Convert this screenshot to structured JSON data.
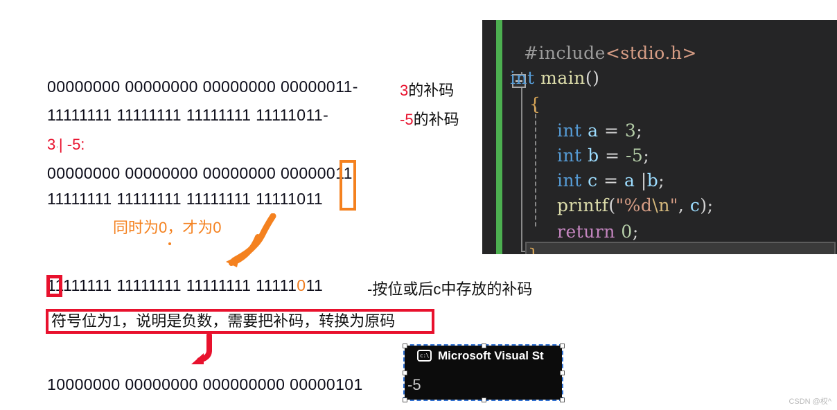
{
  "annotations": {
    "three_complement_bits": "00000000 00000000 00000000 00000011-",
    "three_complement_value": "3",
    "three_complement_label": "的补码",
    "negfive_complement_bits": "11111111 11111111 11111111 11111011-",
    "negfive_complement_value": "-5",
    "negfive_complement_label": "的补码",
    "expression": "3 | -5:",
    "expression_left": "3",
    "expression_dot": "·",
    "expression_right": "| -5:",
    "operand_row_a": "00000000 00000000 00000000 00000011",
    "operand_row_b": "11111111 11111111 11111111 11111011",
    "note_both_zero": "同时为0，才为0",
    "result_bits_prefix": "1",
    "result_bits_mid": "1111111 11111111 11111111 11111",
    "result_bits_orange": "0",
    "result_bits_tail": "11",
    "result_suffix": "-按位或后c中存放的补码",
    "callout_text": "符号位为1，说明是负数，需要把补码，转换为原码",
    "original_code_bits": "10000000 00000000 000000000 00000101"
  },
  "colors": {
    "red": "#e8112d",
    "orange": "#f4811f",
    "text": "#111111",
    "editor_bg": "#252526",
    "change_bar_green": "#4caf50",
    "console_bg": "#0c0c0c",
    "selection_blue": "#2f6fd0"
  },
  "code": {
    "lines": [
      {
        "id": "l1",
        "tokens": [
          {
            "t": "#include",
            "c": "c-pre"
          },
          {
            "t": "<stdio.h>",
            "c": "c-hdr"
          }
        ]
      },
      {
        "id": "l2",
        "tokens": [
          {
            "t": "int",
            "c": "c-kw"
          },
          {
            "t": " ",
            "c": "c-punc"
          },
          {
            "t": "main",
            "c": "c-fn"
          },
          {
            "t": "()",
            "c": "c-punc"
          }
        ]
      },
      {
        "id": "l3",
        "tokens": [
          {
            "t": "{",
            "c": "c-brace"
          }
        ]
      },
      {
        "id": "l4",
        "tokens": [
          {
            "t": "int",
            "c": "c-kw"
          },
          {
            "t": " ",
            "c": "c-punc"
          },
          {
            "t": "a",
            "c": "c-var"
          },
          {
            "t": " = ",
            "c": "c-punc"
          },
          {
            "t": "3",
            "c": "c-num"
          },
          {
            "t": ";",
            "c": "c-punc"
          }
        ]
      },
      {
        "id": "l5",
        "tokens": [
          {
            "t": "int",
            "c": "c-kw"
          },
          {
            "t": " ",
            "c": "c-punc"
          },
          {
            "t": "b",
            "c": "c-var"
          },
          {
            "t": " = ",
            "c": "c-punc"
          },
          {
            "t": "-5",
            "c": "c-num"
          },
          {
            "t": ";",
            "c": "c-punc"
          }
        ]
      },
      {
        "id": "l6",
        "tokens": [
          {
            "t": "int",
            "c": "c-kw"
          },
          {
            "t": " ",
            "c": "c-punc"
          },
          {
            "t": "c",
            "c": "c-var"
          },
          {
            "t": " = ",
            "c": "c-punc"
          },
          {
            "t": "a",
            "c": "c-var"
          },
          {
            "t": " |",
            "c": "c-punc"
          },
          {
            "t": "b",
            "c": "c-var"
          },
          {
            "t": ";",
            "c": "c-punc"
          }
        ]
      },
      {
        "id": "l7",
        "tokens": [
          {
            "t": "printf",
            "c": "c-fn"
          },
          {
            "t": "(",
            "c": "c-punc"
          },
          {
            "t": "\"%d",
            "c": "c-str"
          },
          {
            "t": "\\n",
            "c": "c-esc"
          },
          {
            "t": "\"",
            "c": "c-str"
          },
          {
            "t": ", ",
            "c": "c-punc"
          },
          {
            "t": "c",
            "c": "c-var"
          },
          {
            "t": ");",
            "c": "c-punc"
          }
        ]
      },
      {
        "id": "l8",
        "tokens": [
          {
            "t": "return",
            "c": "c-ret"
          },
          {
            "t": " ",
            "c": "c-punc"
          },
          {
            "t": "0",
            "c": "c-num"
          },
          {
            "t": ";",
            "c": "c-punc"
          }
        ]
      },
      {
        "id": "l9",
        "tokens": [
          {
            "t": "}",
            "c": "c-brace"
          }
        ]
      }
    ]
  },
  "console": {
    "icon": "c:\\",
    "title": "Microsoft Visual St",
    "output": "-5"
  },
  "watermark": "CSDN @权^"
}
